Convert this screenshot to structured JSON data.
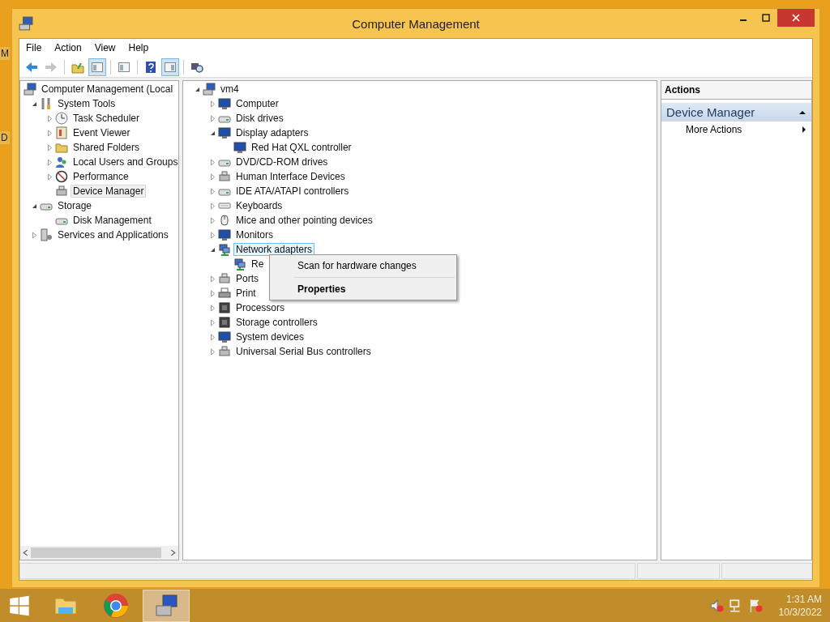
{
  "desktop": {
    "icon_labels": [
      "M",
      "D"
    ]
  },
  "window": {
    "title": "Computer Management"
  },
  "menu_bar": [
    "File",
    "Action",
    "View",
    "Help"
  ],
  "toolbar": [
    {
      "disabled": false,
      "pressed": false
    },
    {
      "disabled": true,
      "pressed": false
    },
    {
      "disabled": false,
      "pressed": false
    },
    {
      "disabled": false,
      "pressed": true
    },
    {
      "disabled": false,
      "pressed": false
    },
    {
      "disabled": false,
      "pressed": false
    },
    {
      "disabled": false,
      "pressed": true
    },
    {
      "disabled": false,
      "pressed": false
    }
  ],
  "console_tree": [
    {
      "label": "Computer Management (Local",
      "selected": false,
      "children": [
        {
          "label": "System Tools",
          "expanded": true,
          "selected": false,
          "children": [
            {
              "label": "Task Scheduler",
              "expanded": false,
              "selected": false
            },
            {
              "label": "Event Viewer",
              "expanded": false,
              "selected": false
            },
            {
              "label": "Shared Folders",
              "expanded": false,
              "selected": false
            },
            {
              "label": "Local Users and Groups",
              "expanded": false,
              "selected": false
            },
            {
              "label": "Performance",
              "expanded": false,
              "selected": false
            },
            {
              "label": "Device Manager",
              "selected": true
            }
          ]
        },
        {
          "label": "Storage",
          "expanded": true,
          "selected": false,
          "children": [
            {
              "label": "Disk Management",
              "selected": false
            }
          ]
        },
        {
          "label": "Services and Applications",
          "expanded": false,
          "selected": false
        }
      ]
    }
  ],
  "device_tree": [
    {
      "label": "vm4",
      "expanded": true,
      "selected": false,
      "children": [
        {
          "label": "Computer",
          "expanded": false,
          "selected": false
        },
        {
          "label": "Disk drives",
          "expanded": false,
          "selected": false
        },
        {
          "label": "Display adapters",
          "expanded": true,
          "selected": false,
          "children": [
            {
              "label": "Red Hat QXL controller",
              "selected": false
            }
          ]
        },
        {
          "label": "DVD/CD-ROM drives",
          "expanded": false,
          "selected": false
        },
        {
          "label": "Human Interface Devices",
          "expanded": false,
          "selected": false
        },
        {
          "label": "IDE ATA/ATAPI controllers",
          "expanded": false,
          "selected": false
        },
        {
          "label": "Keyboards",
          "expanded": false,
          "selected": false
        },
        {
          "label": "Mice and other pointing devices",
          "expanded": false,
          "selected": false
        },
        {
          "label": "Monitors",
          "expanded": false,
          "selected": false
        },
        {
          "label": "Network adapters",
          "expanded": true,
          "selected": true,
          "children": [
            {
              "label": "Re",
              "selected": false
            }
          ]
        },
        {
          "label": "Ports",
          "expanded": false,
          "selected": false
        },
        {
          "label": "Print",
          "expanded": false,
          "selected": false
        },
        {
          "label": "Processors",
          "expanded": false,
          "selected": false
        },
        {
          "label": "Storage controllers",
          "expanded": false,
          "selected": false
        },
        {
          "label": "System devices",
          "expanded": false,
          "selected": false
        },
        {
          "label": "Universal Serial Bus controllers",
          "expanded": false,
          "selected": false
        }
      ]
    }
  ],
  "context_menu": [
    {
      "label": "Scan for hardware changes",
      "default": false
    },
    {
      "label": "Properties",
      "default": true
    }
  ],
  "actions_pane": {
    "header": "Actions",
    "section": {
      "title": "Device Manager",
      "expanded": true,
      "items": [
        {
          "label": "More Actions"
        }
      ]
    }
  },
  "taskbar": {
    "buttons": [
      {
        "selected": false
      },
      {
        "selected": false
      },
      {
        "selected": false
      },
      {
        "selected": true
      }
    ],
    "time": "1:31 AM",
    "date": "10/3/2022"
  }
}
